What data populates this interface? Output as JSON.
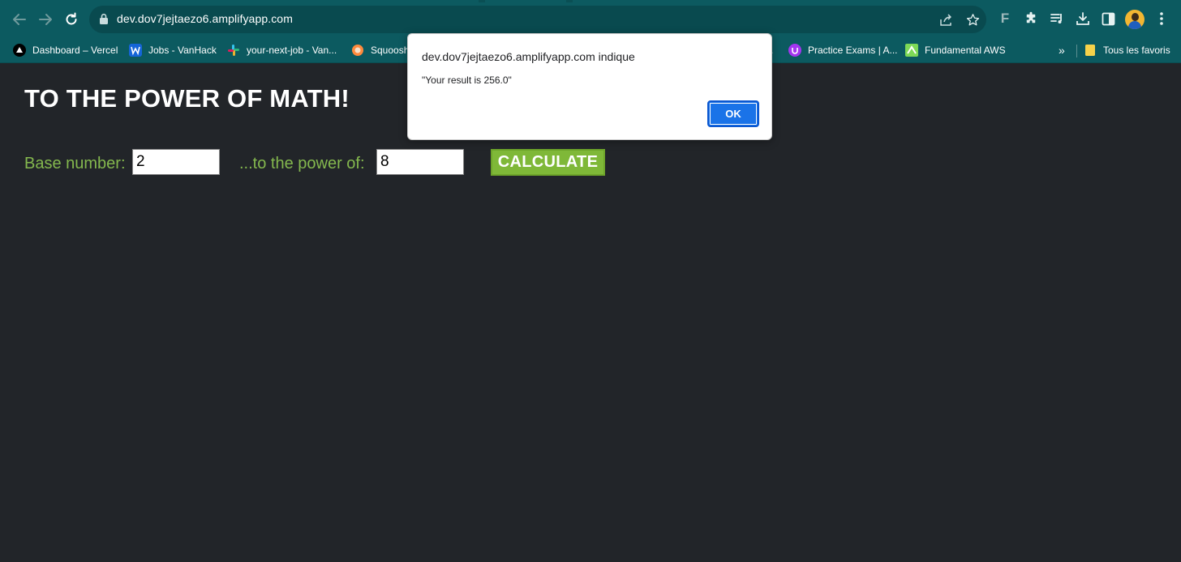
{
  "browser": {
    "url": "dev.dov7jejtaezo6.amplifyapp.com",
    "icons": [
      "back-arrow-icon",
      "forward-arrow-icon",
      "reload-icon",
      "lock-icon",
      "share-icon",
      "star-icon",
      "extension-f-icon",
      "puzzle-icon",
      "media-queue-icon",
      "download-icon",
      "side-panel-icon",
      "avatar",
      "kebab-menu-icon"
    ],
    "extension_letter": "F",
    "toolbar_color": "#0c5a60"
  },
  "bookmarks": {
    "items": [
      {
        "label": "Dashboard – Vercel",
        "icon": "vercel-icon"
      },
      {
        "label": "Jobs - VanHack",
        "icon": "vanhack-icon"
      },
      {
        "label": "your-next-job - Van...",
        "icon": "slack-icon"
      },
      {
        "label": "Squoosh",
        "icon": "squoosh-icon"
      },
      {
        "label": "Practice Exams | A...",
        "icon": "udemy-icon"
      },
      {
        "label": "Fundamental AWS",
        "icon": "aws-course-icon"
      }
    ],
    "partial_hidden": ".",
    "overflow": "»",
    "all_bookmarks": "Tous les favoris"
  },
  "page": {
    "title": "TO THE POWER OF MATH!",
    "base_label": "Base number:",
    "base_value": "2",
    "power_label": "...to the power of:",
    "power_value": "8",
    "calculate_label": "CALCULATE",
    "accent_color": "#84b84e",
    "background_color": "#222529"
  },
  "dialog": {
    "title": "dev.dov7jejtaezo6.amplifyapp.com indique",
    "message": "\"Your result is 256.0\"",
    "ok_label": "OK",
    "button_color": "#1a73e8"
  }
}
